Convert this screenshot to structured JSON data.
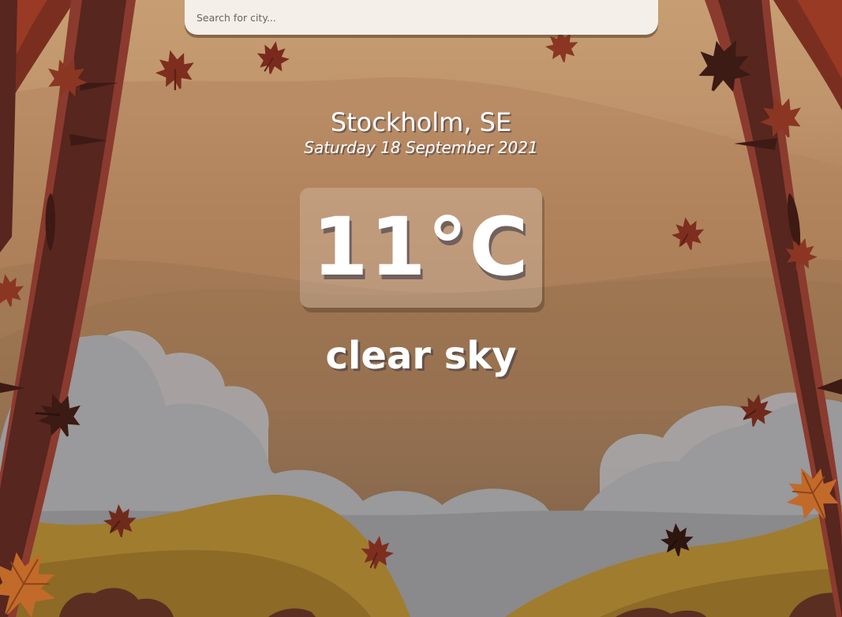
{
  "search": {
    "placeholder": "Search for city...",
    "value": ""
  },
  "location": {
    "city_country": "Stockholm, SE",
    "date": "Saturday 18 September 2021"
  },
  "weather": {
    "temperature": "11°C",
    "description": "clear sky"
  },
  "background": {
    "theme": "autumn-forest-illustration",
    "icons": [
      "maple-leaf-icon",
      "tree-trunk",
      "cloud",
      "hill",
      "bush"
    ]
  },
  "colors": {
    "search_bg": "#f5efea",
    "text": "#ffffff",
    "sky_top": "#c79e72",
    "tree_dark": "#56261f",
    "cloud": "#9c9c9e",
    "hill": "#a07c2e"
  }
}
